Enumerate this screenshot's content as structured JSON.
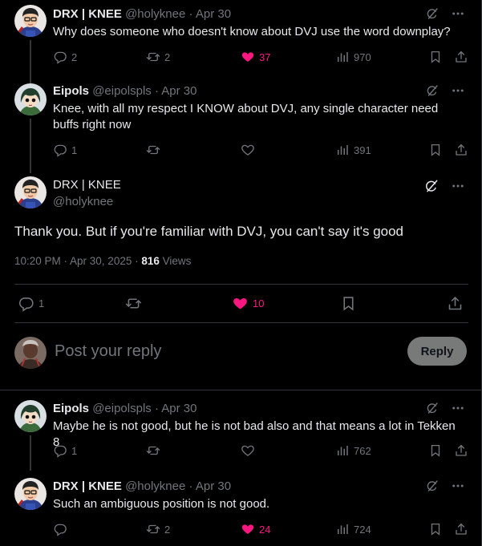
{
  "tweets": [
    {
      "name": "DRX | KNEE",
      "handle": "@holyknee",
      "sep": "·",
      "date": "Apr 30",
      "text": "Why does someone who doesn't know about DVJ use the word downplay?",
      "replies": "2",
      "reposts": "2",
      "likes": "37",
      "views": "970"
    },
    {
      "name": "Eipols",
      "handle": "@eipolspls",
      "sep": "·",
      "date": "Apr 30",
      "text": "Knee, with all my respect I KNOW about DVJ, any single character need buffs right now",
      "replies": "1",
      "reposts": "",
      "likes": "",
      "views": "391"
    }
  ],
  "main": {
    "name": "DRX | KNEE",
    "handle": "@holyknee",
    "text": "Thank you. But if you're familiar with DVJ, you can't say it's good",
    "time": "10:20 PM · Apr 30, 2025 ·",
    "views_count": "816",
    "views_label": "Views",
    "replies": "1",
    "likes": "10"
  },
  "composer": {
    "placeholder": "Post your reply",
    "button": "Reply"
  },
  "replies": [
    {
      "name": "Eipols",
      "handle": "@eipolspls",
      "sep": "·",
      "date": "Apr 30",
      "text": "Maybe he is not good, but he is not bad also and that means a lot in Tekken 8",
      "replies": "1",
      "reposts": "",
      "likes": "",
      "views": "762"
    },
    {
      "name": "DRX | KNEE",
      "handle": "@holyknee",
      "sep": "·",
      "date": "Apr 30",
      "text": "Such an ambiguous position is not good.",
      "replies": "",
      "reposts": "2",
      "likes": "24",
      "views": "724"
    }
  ],
  "colors": {
    "like": "#f91880",
    "muted": "#71767b",
    "text": "#e7e9ea",
    "border": "#2f3336"
  }
}
